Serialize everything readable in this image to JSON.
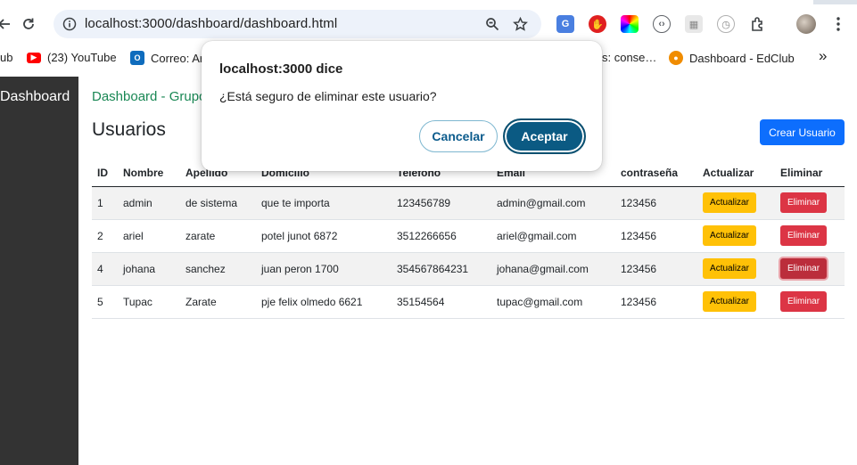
{
  "browser": {
    "url": "localhost:3000/dashboard/dashboard.html",
    "bookmarks": [
      {
        "label": "ub",
        "icon": "bookmark-icon"
      },
      {
        "label": "(23) YouTube",
        "icon": "youtube-icon",
        "color": "#ff0000"
      },
      {
        "label": "Correo: Ar",
        "icon": "outlook-icon",
        "color": "#0f6cbd"
      },
      {
        "label": "s: conse…",
        "icon": "bookmark-icon"
      },
      {
        "label": "Dashboard - EdClub",
        "icon": "edclub-icon",
        "color": "#f08c00"
      }
    ],
    "more_bookmarks_glyph": "»"
  },
  "sidebar": {
    "brand": "Dashboard"
  },
  "header": {
    "breadcrumb": "Dashboard - Grupo",
    "title": "Usuarios",
    "create_button": "Crear Usuario"
  },
  "table": {
    "headers": [
      "ID",
      "Nombre",
      "Apellido",
      "Domicilio",
      "Teléfono",
      "Email",
      "contraseña",
      "Actualizar",
      "Eliminar"
    ],
    "rows": [
      {
        "id": "1",
        "nombre": "admin",
        "apellido": "de sistema",
        "domicilio": "que te importa",
        "telefono": "123456789",
        "email": "admin@gmail.com",
        "contrasena": "123456",
        "actualizar": "Actualizar",
        "eliminar": "Eliminar"
      },
      {
        "id": "2",
        "nombre": "ariel",
        "apellido": "zarate",
        "domicilio": "potel junot 6872",
        "telefono": "3512266656",
        "email": "ariel@gmail.com",
        "contrasena": "123456",
        "actualizar": "Actualizar",
        "eliminar": "Eliminar"
      },
      {
        "id": "4",
        "nombre": "johana",
        "apellido": "sanchez",
        "domicilio": "juan peron 1700",
        "telefono": "354567864231",
        "email": "johana@gmail.com",
        "contrasena": "123456",
        "actualizar": "Actualizar",
        "eliminar": "Eliminar"
      },
      {
        "id": "5",
        "nombre": "Tupac",
        "apellido": "Zarate",
        "domicilio": "pje felix olmedo 6621",
        "telefono": "35154564",
        "email": "tupac@gmail.com",
        "contrasena": "123456",
        "actualizar": "Actualizar",
        "eliminar": "Eliminar"
      }
    ]
  },
  "dialog": {
    "title": "localhost:3000 dice",
    "message": "¿Está seguro de eliminar este usuario?",
    "cancel": "Cancelar",
    "ok": "Aceptar"
  },
  "colors": {
    "sidebar_bg": "#333333",
    "breadcrumb": "#198754",
    "primary": "#0d6efd",
    "warning": "#ffc107",
    "danger": "#dc3545",
    "dialog_accent": "#0b5a83"
  }
}
